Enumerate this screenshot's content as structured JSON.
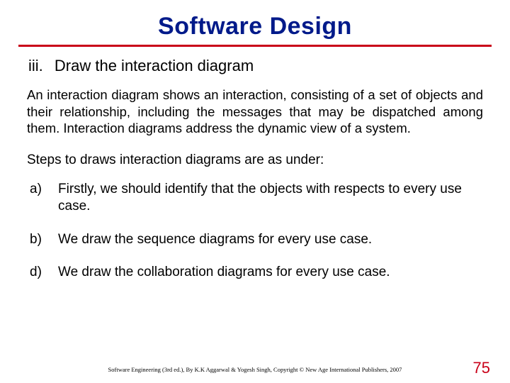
{
  "title": "Software Design",
  "section": {
    "numeral": "iii.",
    "heading": "Draw the interaction diagram"
  },
  "paragraph": "An interaction diagram shows an interaction, consisting of a set of objects and their relationship, including the messages that may be dispatched among them. Interaction diagrams address the dynamic view of a system.",
  "steps_intro": "Steps to draws interaction diagrams are as under:",
  "steps": [
    {
      "label": "a)",
      "text": "Firstly, we should identify that the objects with respects to every use case."
    },
    {
      "label": "b)",
      "text": "We draw the sequence diagrams for every use case."
    },
    {
      "label": "d)",
      "text": "We draw the collaboration diagrams for every use case."
    }
  ],
  "footer": "Software Engineering (3rd ed.), By K.K Aggarwal & Yogesh Singh, Copyright © New Age International Publishers, 2007",
  "page_number": "75"
}
